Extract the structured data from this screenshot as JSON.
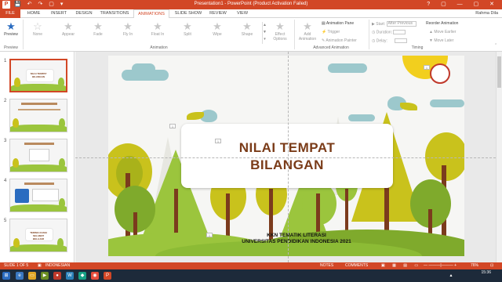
{
  "window": {
    "title": "Presentation1 - PowerPoint (Product Activation Failed)",
    "user": "Rahma Dila",
    "controls": "? ▢ — ▢ ✕"
  },
  "qat": "💾 ↶ ↷ ▢ ▾",
  "tabs": [
    "FILE",
    "HOME",
    "INSERT",
    "DESIGN",
    "TRANSITIONS",
    "ANIMATIONS",
    "SLIDE SHOW",
    "REVIEW",
    "VIEW"
  ],
  "active_tab": "ANIMATIONS",
  "ribbon": {
    "preview_label": "Preview",
    "preview_group": "Preview",
    "animations": [
      "None",
      "Appear",
      "Fade",
      "Fly In",
      "Float In",
      "Split",
      "Wipe",
      "Shape"
    ],
    "effect_options": "Effect Options",
    "animation_group": "Animation",
    "add_animation": "Add Animation",
    "animation_pane": "Animation Pane",
    "trigger": "Trigger",
    "animation_painter": "Animation Painter",
    "advanced_group": "Advanced Animation",
    "start_label": "Start:",
    "start_value": "After Previous",
    "duration_label": "Duration:",
    "delay_label": "Delay:",
    "timing_group": "Timing",
    "reorder_title": "Reorder Animation",
    "move_earlier": "Move Earlier",
    "move_later": "Move Later"
  },
  "thumbnails": [
    {
      "num": "1",
      "caption": "NILAI TEMPAT BILANGAN",
      "selected": true
    },
    {
      "num": "2",
      "caption": "",
      "selected": false
    },
    {
      "num": "3",
      "caption": "",
      "selected": false
    },
    {
      "num": "4",
      "caption": "",
      "selected": false
    },
    {
      "num": "5",
      "caption": "TERIMA KASIH SELAMAT BELAJAR",
      "selected": false
    }
  ],
  "slide": {
    "title_line1": "NILAI TEMPAT",
    "title_line2": "BILANGAN",
    "subtitle_line1": "KKN TEMATIK LITERASI",
    "subtitle_line2": "UNIVERSITAS PENDIDIKAN INDONESIA 2021",
    "placeholder_number": "1"
  },
  "status": {
    "slide_info": "SLIDE 1 OF 5",
    "language": "INDONESIAN",
    "notes": "NOTES",
    "comments": "COMMENTS",
    "zoom": "76%"
  },
  "taskbar": {
    "time": "15:36"
  },
  "colors": {
    "accent": "#d24726",
    "title_text": "#7a3b18",
    "trunk": "#7b3b1d",
    "leaf_green": "#9bc53d",
    "leaf_yellow": "#c9c21c",
    "sky_cloud": "#9cc8cc",
    "sun": "#f2cf1e"
  }
}
